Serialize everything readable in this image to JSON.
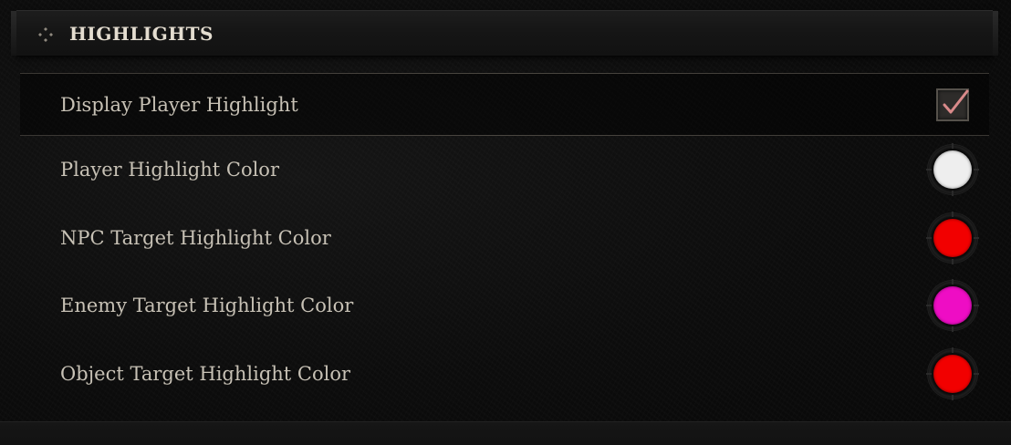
{
  "section": {
    "title": "HIGHLIGHTS",
    "icon": "diamond-cluster-icon"
  },
  "settings": {
    "display_player_highlight": {
      "label": "Display Player Highlight",
      "checked": true
    },
    "player_highlight_color": {
      "label": "Player Highlight Color",
      "color": "#eeeeee"
    },
    "npc_target_highlight_color": {
      "label": "NPC Target Highlight Color",
      "color": "#f20000"
    },
    "enemy_target_highlight_color": {
      "label": "Enemy Target Highlight Color",
      "color": "#ee0dc4"
    },
    "object_target_highlight_color": {
      "label": "Object Target Highlight Color",
      "color": "#f20000"
    }
  },
  "colors": {
    "checkmark": "#d98a8a",
    "label_text": "#c7c1b5",
    "header_text": "#e4ddd0"
  }
}
